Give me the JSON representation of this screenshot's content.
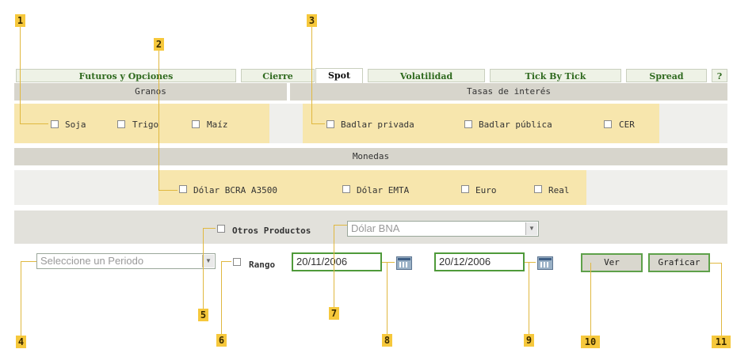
{
  "tabs": [
    {
      "label": "Futuros y Opciones"
    },
    {
      "label": "Cierre"
    },
    {
      "label": "Spot"
    },
    {
      "label": "Volatilidad"
    },
    {
      "label": "Tick By Tick"
    },
    {
      "label": "Spread"
    },
    {
      "label": "?"
    }
  ],
  "granos": {
    "header": "Granos",
    "items": [
      {
        "label": "Soja"
      },
      {
        "label": "Trigo"
      },
      {
        "label": "Maíz"
      }
    ]
  },
  "tasas": {
    "header": "Tasas de interés",
    "items": [
      {
        "label": "Badlar privada"
      },
      {
        "label": "Badlar pública"
      },
      {
        "label": "CER"
      }
    ]
  },
  "monedas": {
    "header": "Monedas",
    "items": [
      {
        "label": "Dólar BCRA A3500"
      },
      {
        "label": "Dólar EMTA"
      },
      {
        "label": "Euro"
      },
      {
        "label": "Real"
      }
    ]
  },
  "otros": {
    "label": "Otros Productos",
    "select_value": "Dólar BNA"
  },
  "periodo": {
    "select_value": "Seleccione un Periodo",
    "rango_label": "Rango",
    "date_from": "20/11/2006",
    "date_to": "20/12/2006",
    "ver_label": "Ver",
    "graficar_label": "Graficar"
  },
  "callouts": [
    "1",
    "2",
    "3",
    "4",
    "5",
    "6",
    "7",
    "8",
    "9",
    "10",
    "11"
  ],
  "colors": {
    "callout": "#f6c83c",
    "highlight": "#f7e6ad",
    "accent_green": "#4f9a3a",
    "header_bg": "#d7d5cc"
  }
}
